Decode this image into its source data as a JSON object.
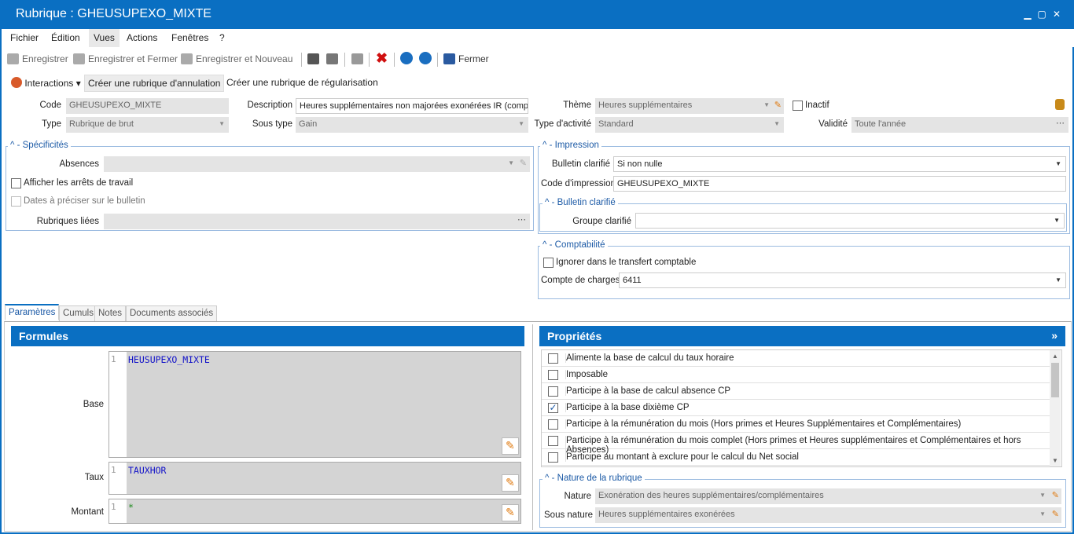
{
  "window": {
    "title": "Rubrique : GHEUSUPEXO_MIXTE"
  },
  "menu": [
    "Fichier",
    "Édition",
    "Vues",
    "Actions",
    "Fenêtres",
    "?"
  ],
  "toolbar": {
    "save": "Enregistrer",
    "save_close": "Enregistrer et Fermer",
    "save_new": "Enregistrer et Nouveau",
    "close": "Fermer"
  },
  "actions": {
    "interactions": "Interactions",
    "cancel": "Créer une rubrique d'annulation",
    "regul": "Créer une rubrique de régularisation"
  },
  "header": {
    "code_label": "Code",
    "code": "GHEUSUPEXO_MIXTE",
    "desc_label": "Description",
    "desc": "Heures supplémentaires non majorées exonérées IR (compe",
    "theme_label": "Thème",
    "theme": "Heures supplémentaires",
    "inactive": "Inactif",
    "type_label": "Type",
    "type": "Rubrique de brut",
    "subtype_label": "Sous type",
    "subtype": "Gain",
    "activity_label": "Type d'activité",
    "activity": "Standard",
    "validity_label": "Validité",
    "validity": "Toute l'année"
  },
  "spec": {
    "title": "Spécificités",
    "absences": "Absences",
    "stops": "Afficher les arrêts de travail",
    "dates": "Dates à préciser sur le bulletin",
    "linked": "Rubriques liées"
  },
  "impression": {
    "title": "Impression",
    "clarified_label": "Bulletin clarifié",
    "clarified": "Si non nulle",
    "code_label": "Code d'impression",
    "code": "GHEUSUPEXO_MIXTE"
  },
  "bulletin": {
    "title": "Bulletin clarifié",
    "group_label": "Groupe clarifié"
  },
  "compta": {
    "title": "Comptabilité",
    "ignore": "Ignorer dans le transfert comptable",
    "account_label": "Compte de charges",
    "account": "6411"
  },
  "tabs": [
    "Paramètres",
    "Cumuls",
    "Notes",
    "Documents associés"
  ],
  "formulas": {
    "title": "Formules",
    "base_label": "Base",
    "base": "HEUSUPEXO_MIXTE",
    "rate_label": "Taux",
    "rate": "TAUXHOR",
    "amount_label": "Montant",
    "amount": "*",
    "line": "1"
  },
  "props": {
    "title": "Propriétés",
    "rows": [
      "Alimente la base de calcul du taux horaire",
      "Imposable",
      "Participe à la base de calcul absence CP",
      "Participe à la base dixième CP",
      "Participe à la rémunération du mois (Hors primes et Heures Supplémentaires et Complémentaires)",
      "Participe à la rémunération du mois complet (Hors primes et Heures supplémentaires et Complémentaires et hors Absences)",
      "Participe au montant à exclure pour le calcul du Net social"
    ],
    "checked": [
      false,
      false,
      false,
      true,
      false,
      false,
      false
    ]
  },
  "nature": {
    "title": "Nature de la rubrique",
    "nature_label": "Nature",
    "nature": "Exonération des heures supplémentaires/complémentaires",
    "subnature_label": "Sous nature",
    "subnature": "Heures supplémentaires exonérées"
  }
}
